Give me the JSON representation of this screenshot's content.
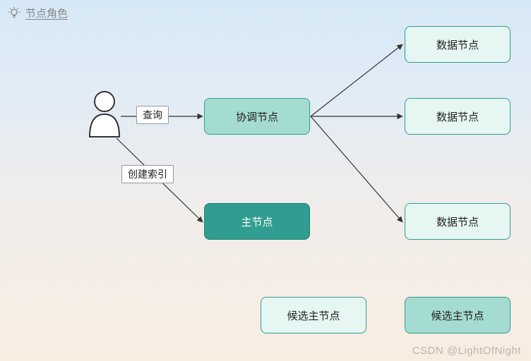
{
  "title": "节点角色",
  "labels": {
    "query": "查询",
    "create_index": "创建索引"
  },
  "nodes": {
    "coord": "协调节点",
    "master": "主节点",
    "data1": "数据节点",
    "data2": "数据节点",
    "data3": "数据节点",
    "candidate1": "候选主节点",
    "candidate2": "候选主节点"
  },
  "watermark": "CSDN @LightOfNight"
}
